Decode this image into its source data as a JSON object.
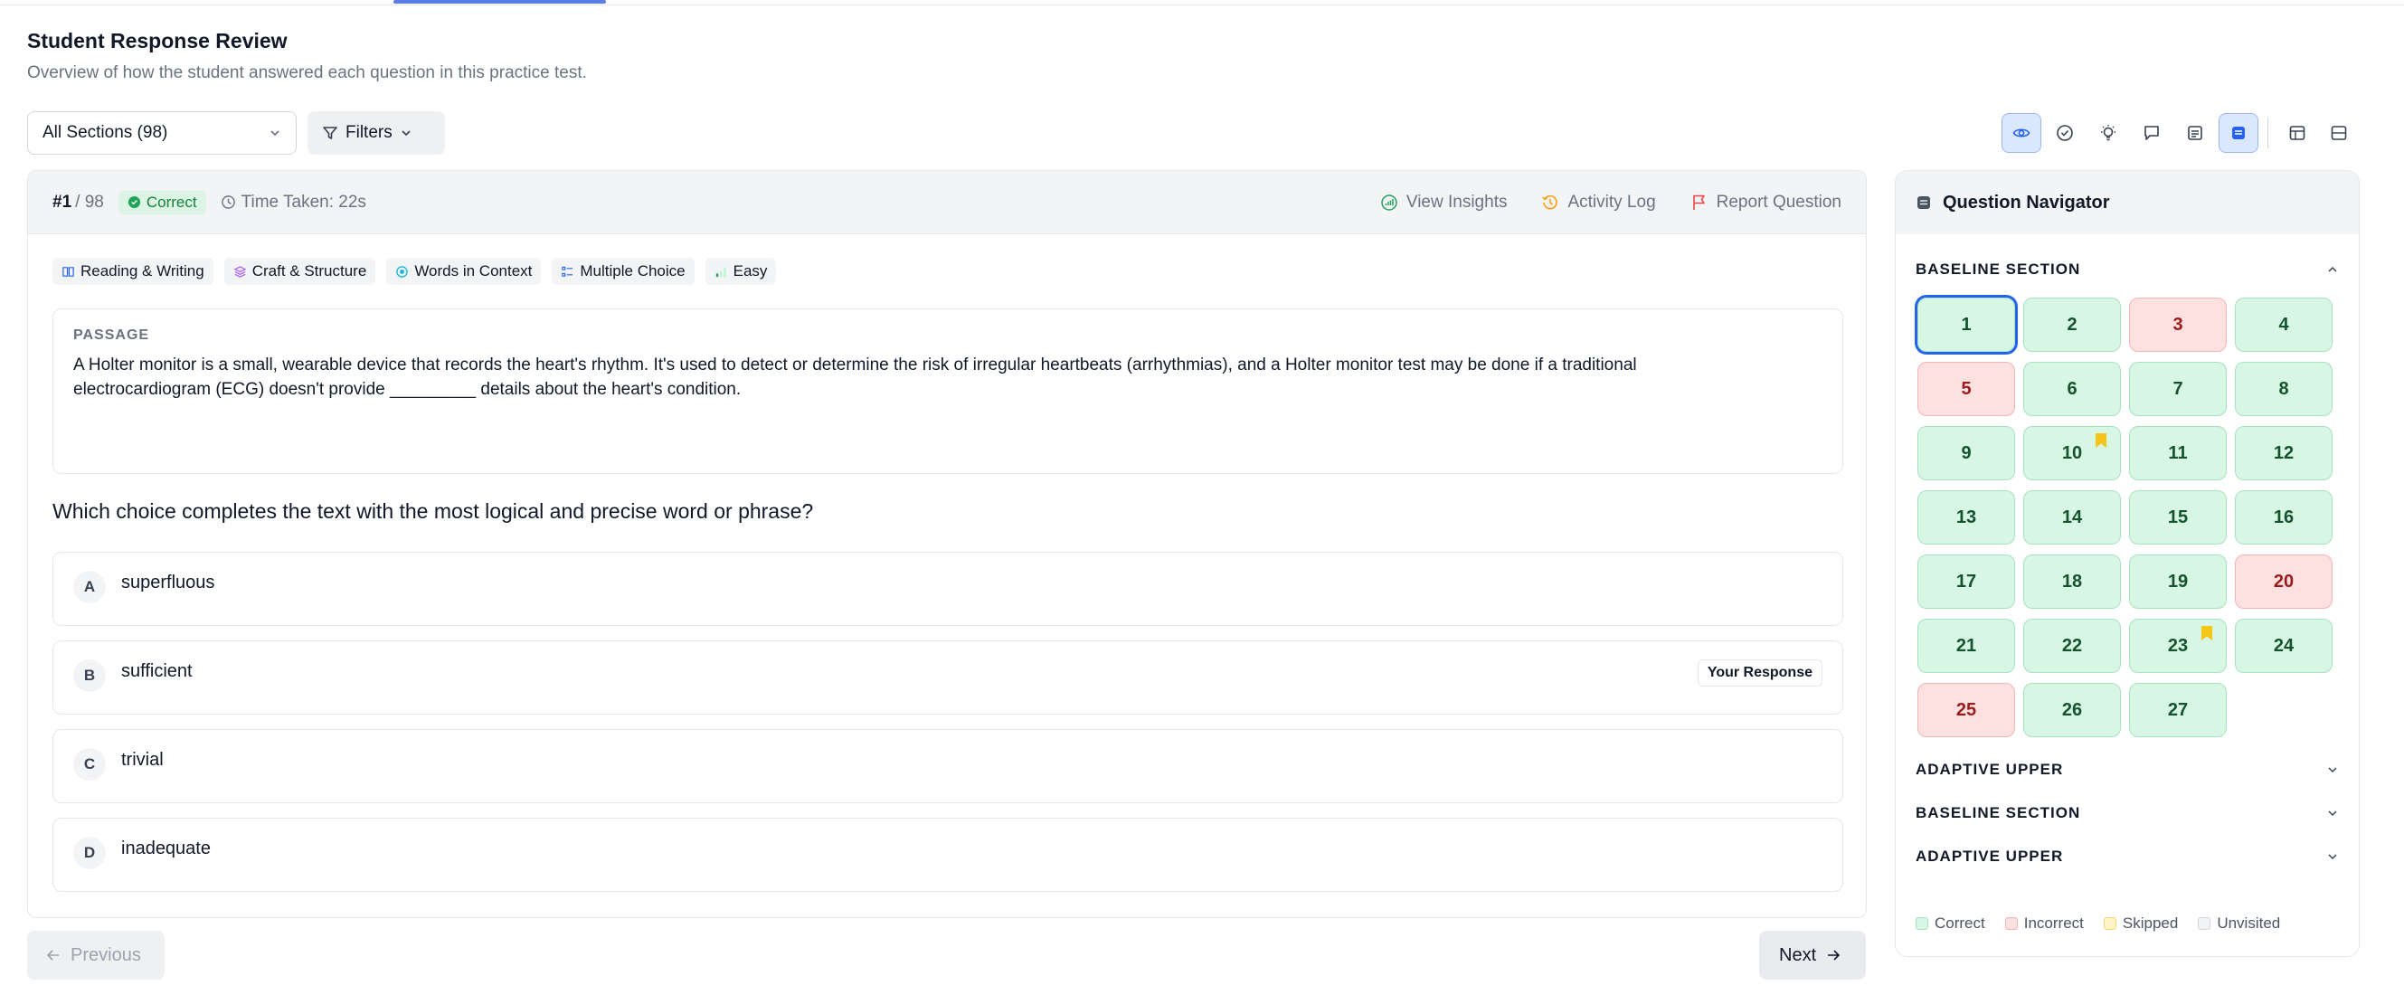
{
  "header": {
    "title": "Student Response Review",
    "subtitle": "Overview of how the student answered each question in this practice test."
  },
  "controls": {
    "section_select": "All Sections (98)",
    "filters_label": "Filters"
  },
  "toolbar": {
    "icons": [
      "eye-icon",
      "check-circle-icon",
      "lightbulb-icon",
      "comment-icon",
      "notes-icon",
      "list-icon",
      "table-icon",
      "split-icon"
    ]
  },
  "question": {
    "number": "#1",
    "total": "/ 98",
    "status": "Correct",
    "time_taken": "Time Taken: 22s",
    "actions": {
      "insights": "View Insights",
      "activity": "Activity Log",
      "report": "Report Question"
    },
    "tags": [
      "Reading & Writing",
      "Craft & Structure",
      "Words in Context",
      "Multiple Choice",
      "Easy"
    ],
    "passage_label": "PASSAGE",
    "passage_line1": "A Holter monitor is a small, wearable device that records the heart's rhythm. It's used to detect or determine the risk of irregular heartbeats (arrhythmias), and a Holter monitor test may be done if a traditional",
    "passage_line2": "electrocardiogram (ECG) doesn't provide _________ details about the heart's condition.",
    "prompt": "Which choice completes the text with the most logical and precise word or phrase?",
    "choices": [
      {
        "letter": "A",
        "text": "superfluous"
      },
      {
        "letter": "B",
        "text": "sufficient",
        "badge": "Your Response"
      },
      {
        "letter": "C",
        "text": "trivial"
      },
      {
        "letter": "D",
        "text": "inadequate"
      }
    ]
  },
  "pager": {
    "previous": "Previous",
    "next": "Next"
  },
  "navigator": {
    "title": "Question Navigator",
    "sections": [
      {
        "name": "BASELINE SECTION",
        "expanded": true
      },
      {
        "name": "ADAPTIVE UPPER",
        "expanded": false
      },
      {
        "name": "BASELINE SECTION",
        "expanded": false
      },
      {
        "name": "ADAPTIVE UPPER",
        "expanded": false
      }
    ],
    "cells": [
      {
        "n": "1",
        "status": "correct",
        "current": true
      },
      {
        "n": "2",
        "status": "correct"
      },
      {
        "n": "3",
        "status": "incorrect"
      },
      {
        "n": "4",
        "status": "correct"
      },
      {
        "n": "5",
        "status": "incorrect"
      },
      {
        "n": "6",
        "status": "correct"
      },
      {
        "n": "7",
        "status": "correct"
      },
      {
        "n": "8",
        "status": "correct"
      },
      {
        "n": "9",
        "status": "correct"
      },
      {
        "n": "10",
        "status": "correct",
        "bookmarked": true
      },
      {
        "n": "11",
        "status": "correct"
      },
      {
        "n": "12",
        "status": "correct"
      },
      {
        "n": "13",
        "status": "correct"
      },
      {
        "n": "14",
        "status": "correct"
      },
      {
        "n": "15",
        "status": "correct"
      },
      {
        "n": "16",
        "status": "correct"
      },
      {
        "n": "17",
        "status": "correct"
      },
      {
        "n": "18",
        "status": "correct"
      },
      {
        "n": "19",
        "status": "correct"
      },
      {
        "n": "20",
        "status": "incorrect"
      },
      {
        "n": "21",
        "status": "correct"
      },
      {
        "n": "22",
        "status": "correct"
      },
      {
        "n": "23",
        "status": "correct",
        "bookmarked": true
      },
      {
        "n": "24",
        "status": "correct"
      },
      {
        "n": "25",
        "status": "incorrect"
      },
      {
        "n": "26",
        "status": "correct"
      },
      {
        "n": "27",
        "status": "correct"
      }
    ],
    "legend": [
      {
        "label": "Correct",
        "color": "#d7f6e3",
        "border": "#a7e3bf"
      },
      {
        "label": "Incorrect",
        "color": "#fde0e0",
        "border": "#f4b4b4"
      },
      {
        "label": "Skipped",
        "color": "#fdf3c4",
        "border": "#ecd77f"
      },
      {
        "label": "Unvisited",
        "color": "#f3f4f6",
        "border": "#d1d5db"
      }
    ]
  },
  "colors": {
    "accent": "#2563eb",
    "correct_text": "#16803c",
    "bookmark": "#f5c518"
  }
}
